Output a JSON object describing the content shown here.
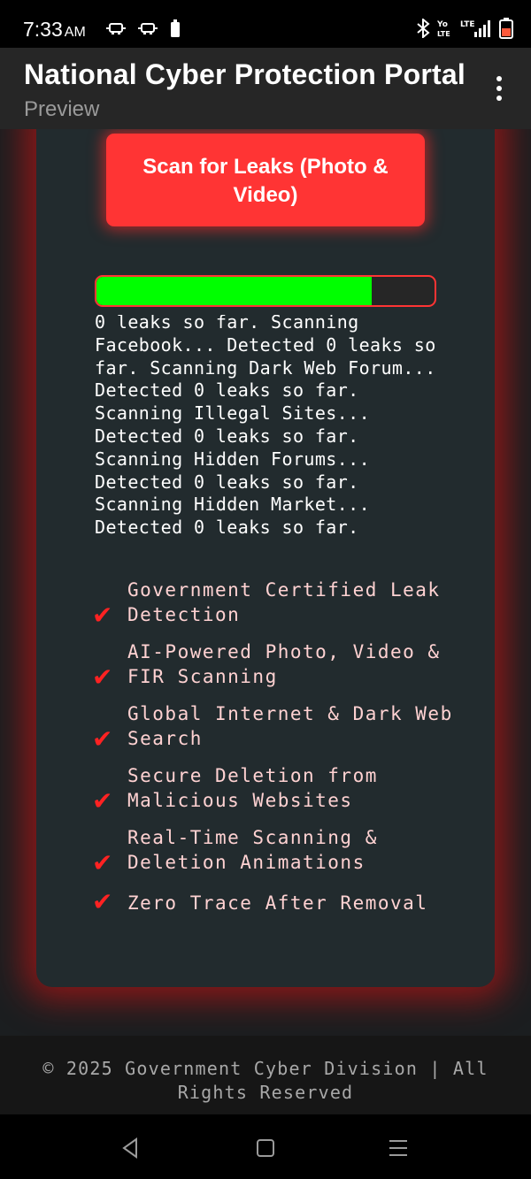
{
  "status_bar": {
    "time": "7:33",
    "ampm": "AM",
    "left_icons": [
      "drive-mode-icon",
      "drive-mode-icon",
      "battery-saver-icon"
    ],
    "right_icons": [
      "bluetooth-icon",
      "volte-icon",
      "lte-signal-icon",
      "battery-icon"
    ]
  },
  "app_bar": {
    "title": "National Cyber Protection Portal",
    "subtitle": "Preview",
    "menu_icon": "more-vert-icon"
  },
  "scan_button": {
    "label": "Scan for Leaks (Photo & Video)"
  },
  "progress": {
    "fraction": 0.815,
    "fill_color": "#00ff00",
    "border_color": "#ff3434"
  },
  "scan_log": {
    "lines": [
      "0 leaks so far. Scanning",
      "Facebook... Detected 0 leaks so",
      "far. Scanning Dark Web Forum...",
      "Detected 0 leaks so far.",
      "Scanning Illegal Sites...",
      "Detected 0 leaks so far.",
      "Scanning Hidden Forums...",
      "Detected 0 leaks so far.",
      "Scanning Hidden Market...",
      "Detected 0 leaks so far."
    ]
  },
  "features": {
    "check_symbol": "✔",
    "items": [
      {
        "text": "Government Certified Leak Detection"
      },
      {
        "text": "AI-Powered Photo, Video & FIR Scanning"
      },
      {
        "text": "Global Internet & Dark Web Search"
      },
      {
        "text": "Secure Deletion from Malicious Websites"
      },
      {
        "text": "Real-Time Scanning & Deletion Animations"
      },
      {
        "text": "Zero Trace After Removal"
      }
    ]
  },
  "footer": {
    "text": "© 2025 Government Cyber Division | All Rights Reserved"
  },
  "nav_bar": {
    "icons": [
      "back-icon",
      "home-icon",
      "recents-icon"
    ]
  },
  "colors": {
    "accent_red": "#ff3434",
    "progress_green": "#00ff00",
    "card_bg": "#222b2e",
    "app_bar_bg": "#262626"
  }
}
